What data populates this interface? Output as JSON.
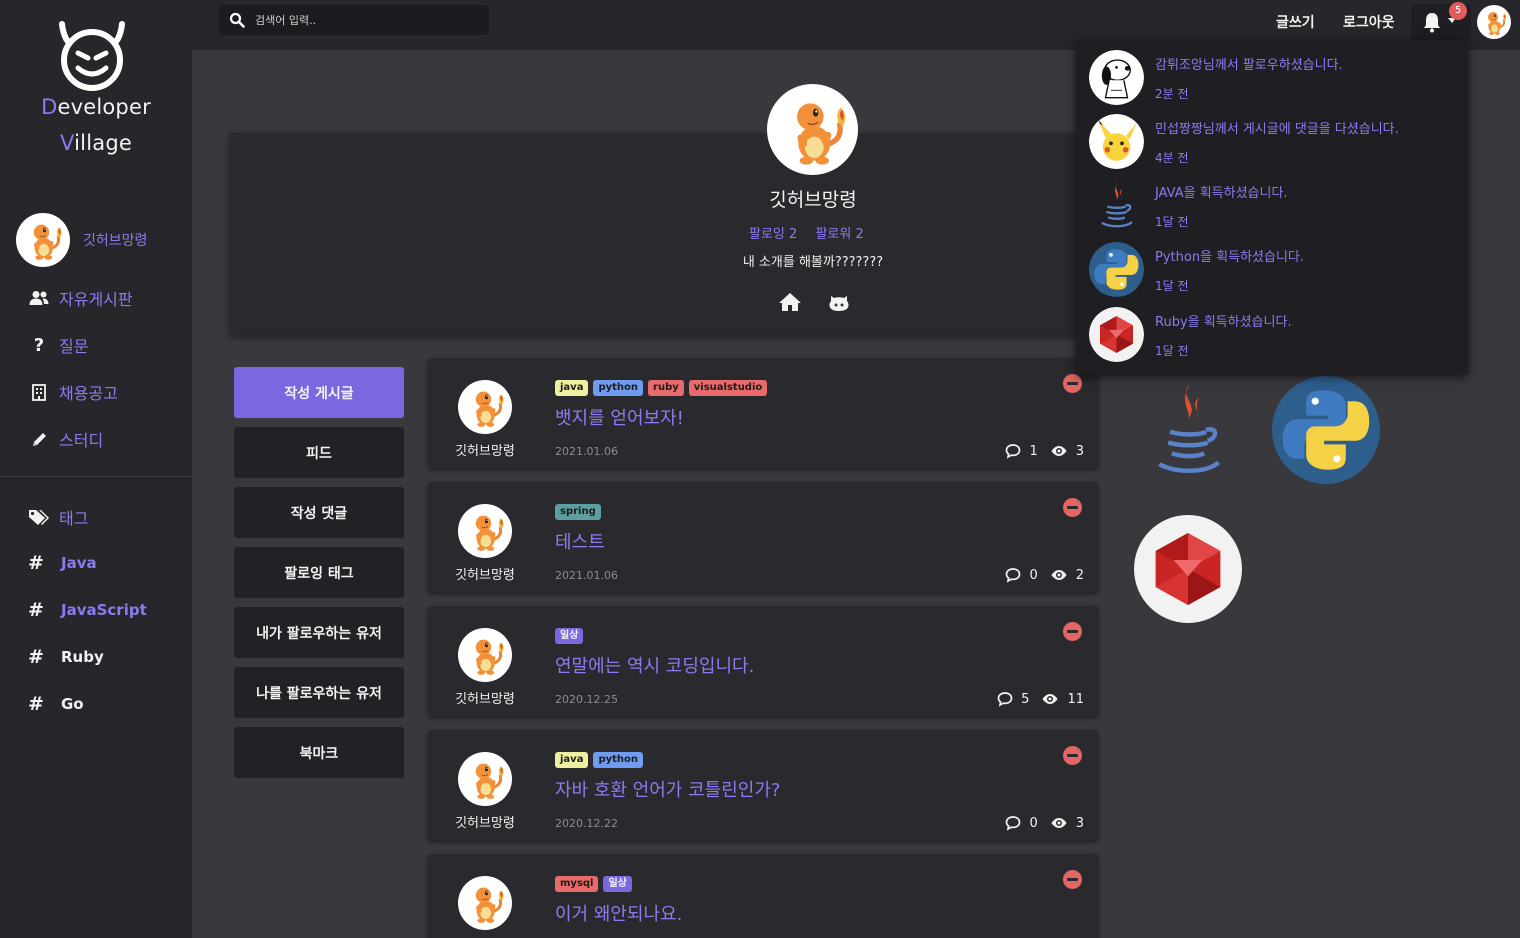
{
  "brand": {
    "line1_first": "D",
    "line1_rest": "eveloper",
    "line2_first": "V",
    "line2_rest": "illage"
  },
  "sidebar": {
    "user_name": "깃허브망령",
    "nav": [
      {
        "label": "자유게시판",
        "icon": "users-icon"
      },
      {
        "label": "질문",
        "icon": "question-icon"
      },
      {
        "label": "채용공고",
        "icon": "building-icon"
      },
      {
        "label": "스터디",
        "icon": "pencil-icon"
      }
    ],
    "tags_title": "태그",
    "tags": [
      {
        "hash": "#",
        "label": "Java",
        "color": "#8a7cf0"
      },
      {
        "hash": "#",
        "label": "JavaScript",
        "color": "#8a7cf0"
      },
      {
        "hash": "#",
        "label": "Ruby",
        "color": "#f2f2f2"
      },
      {
        "hash": "#",
        "label": "Go",
        "color": "#f2f2f2"
      }
    ]
  },
  "topbar": {
    "search_placeholder": "검색어 입력..",
    "write_label": "글쓰기",
    "logout_label": "로그아웃",
    "notification_count": "5"
  },
  "profile": {
    "name": "깃허브망령",
    "following": "팔로잉 2",
    "followers": "팔로워 2",
    "bio": "내 소개를 해볼까???????"
  },
  "tabs": [
    {
      "label": "작성 게시글",
      "active": true
    },
    {
      "label": "피드",
      "active": false
    },
    {
      "label": "작성 댓글",
      "active": false
    },
    {
      "label": "팔로잉 태그",
      "active": false
    },
    {
      "label": "내가 팔로우하는 유저",
      "active": false
    },
    {
      "label": "나를 팔로우하는 유저",
      "active": false
    },
    {
      "label": "북마크",
      "active": false
    }
  ],
  "tag_colors": {
    "java": "#efefa0",
    "python": "#6f9cf0",
    "ruby": "#e96a6a",
    "visualstudio": "#e96a6a",
    "spring": "#5f9ea0",
    "일상": "#7b68e0",
    "mysql": "#e96a6a"
  },
  "posts": [
    {
      "author": "깃허브망령",
      "tags": [
        "java",
        "python",
        "ruby",
        "visualstudio"
      ],
      "title": "뱃지를 얻어보자!",
      "date": "2021.01.06",
      "comments": "1",
      "views": "3"
    },
    {
      "author": "깃허브망령",
      "tags": [
        "spring"
      ],
      "title": "테스트",
      "date": "2021.01.06",
      "comments": "0",
      "views": "2"
    },
    {
      "author": "깃허브망령",
      "tags": [
        "일상"
      ],
      "title": "연말에는 역시 코딩입니다.",
      "date": "2020.12.25",
      "comments": "5",
      "views": "11"
    },
    {
      "author": "깃허브망령",
      "tags": [
        "java",
        "python"
      ],
      "title": "자바 호환 언어가 코틀린인가?",
      "date": "2020.12.22",
      "comments": "0",
      "views": "3"
    },
    {
      "author": "깃허브망령",
      "tags": [
        "mysql",
        "일상"
      ],
      "title": "이거 왜안되나요.",
      "date": "",
      "comments": "",
      "views": ""
    }
  ],
  "badges": [
    "java-badge",
    "python-badge",
    "ruby-badge"
  ],
  "notifications": [
    {
      "message": "감튀조앙님께서 팔로우하셨습니다.",
      "time": "2분 전",
      "image": "snoopy-avatar"
    },
    {
      "message": "민섭짱짱님께서 게시글에 댓글을 다셨습니다.",
      "time": "4분 전",
      "image": "pikachu-avatar"
    },
    {
      "message": "JAVA을 획득하셨습니다.",
      "time": "1달 전",
      "image": "java-logo"
    },
    {
      "message": "Python을 획득하셨습니다.",
      "time": "1달 전",
      "image": "python-logo"
    },
    {
      "message": "Ruby을 획득하셨습니다.",
      "time": "1달 전",
      "image": "ruby-logo"
    }
  ]
}
